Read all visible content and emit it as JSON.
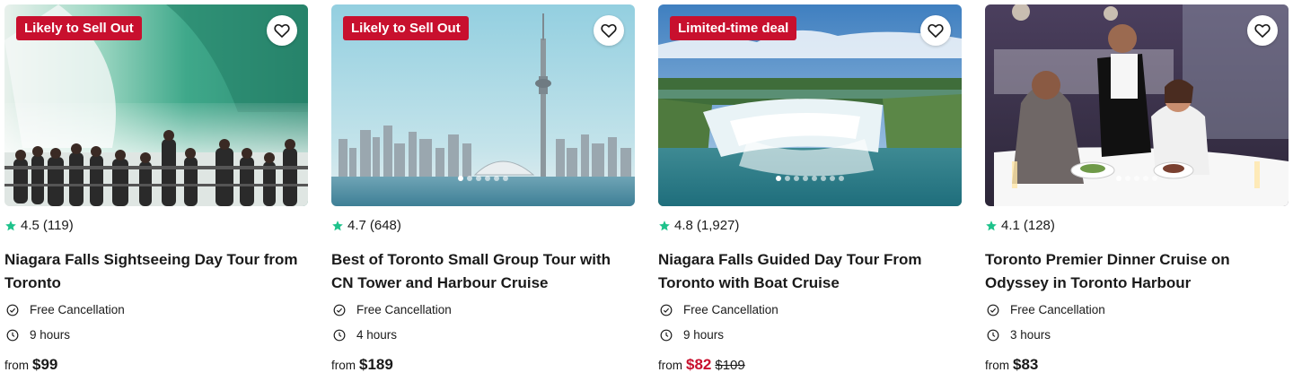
{
  "colors": {
    "badge": "#c8102e",
    "star": "#1ec28b",
    "deal_price": "#c8102e"
  },
  "cards": [
    {
      "badge": "Likely to Sell Out",
      "rating": "4.5",
      "review_count": "(119)",
      "title": "Niagara Falls Sightseeing Day Tour from Toronto",
      "feature_1": "Free Cancellation",
      "feature_2": "9 hours",
      "price_prefix": "from",
      "price": "$99",
      "image_icon": "niagara-falls-crowd-photo"
    },
    {
      "badge": "Likely to Sell Out",
      "rating": "4.7",
      "review_count": "(648)",
      "title": "Best of Toronto Small Group Tour with CN Tower and Harbour Cruise",
      "feature_1": "Free Cancellation",
      "feature_2": "4 hours",
      "price_prefix": "from",
      "price": "$189",
      "image_icon": "toronto-skyline-photo"
    },
    {
      "badge": "Limited-time deal",
      "rating": "4.8",
      "review_count": "(1,927)",
      "title": "Niagara Falls Guided Day Tour From Toronto with Boat Cruise",
      "feature_1": "Free Cancellation",
      "feature_2": "9 hours",
      "price_prefix": "from",
      "price": "$82",
      "original_price": "$109",
      "image_icon": "horseshoe-falls-aerial-photo"
    },
    {
      "rating": "4.1",
      "review_count": "(128)",
      "title": "Toronto Premier Dinner Cruise on Odyssey in Toronto Harbour",
      "feature_1": "Free Cancellation",
      "feature_2": "3 hours",
      "price_prefix": "from",
      "price": "$83",
      "image_icon": "dinner-cruise-photo"
    }
  ]
}
